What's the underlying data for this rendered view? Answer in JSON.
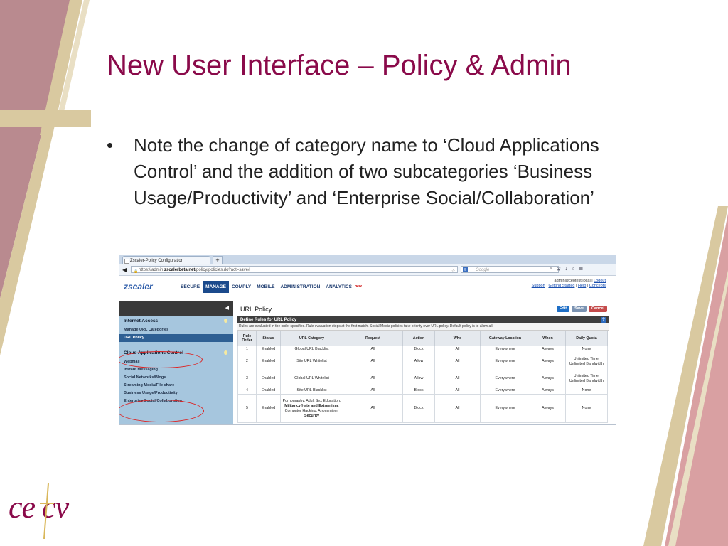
{
  "slide": {
    "title": "New User Interface – Policy & Admin",
    "bullet": "Note the change of category name to ‘Cloud Applications Control’ and the addition of two subcategories ‘Business Usage/Productivity’ and ‘Enterprise Social/Collaboration’",
    "logo": "ce  cv"
  },
  "colors": {
    "title": "#8a0a4a",
    "accent_tan": "#d9c9a0",
    "accent_rose": "#b98a8f"
  },
  "browser": {
    "tab_title": "Zscaler-Policy Configuration",
    "new_tab": "+",
    "url_prefix": "https://admin.",
    "url_host": "zscalerbeta.net",
    "url_path": "/policy/policies.do?act=save#",
    "search_engine": "Google",
    "search_placeholder": "Google"
  },
  "app": {
    "logo": "zscaler",
    "nav": [
      "SECURE",
      "MANAGE",
      "COMPLY",
      "MOBILE",
      "ADMINISTRATION",
      "ANALYTICS"
    ],
    "nav_new": "new",
    "user": "admin@ceotest.local",
    "logout": "Logout",
    "support": "Support",
    "getting_started": "Getting Started",
    "help": "Help",
    "concepts": "Concepts"
  },
  "sidebar": {
    "sections": [
      {
        "title": "Internet Access",
        "items": [
          "Manage URL Categories",
          "URL Policy"
        ]
      },
      {
        "title": "Cloud Applications Control",
        "items": [
          "Webmail",
          "Instant Messaging",
          "Social Networks/Blogs",
          "Streaming Media/File share",
          "Business Usage/Productivity",
          "Enterprise Social/Collaboration"
        ]
      }
    ]
  },
  "main": {
    "title": "URL Policy",
    "buttons": {
      "edit": "Edit",
      "save": "Save",
      "cancel": "Cancel"
    },
    "define_title": "Define Rules for URL Policy",
    "help": "?",
    "note": "Rules are evaluated in the order specified. Rule evaluation stops at the first match. Social Media policies take priority over URL policy. Default policy is to allow all.",
    "columns": [
      "Rule Order",
      "Status",
      "URL Category",
      "Request",
      "Action",
      "Who",
      "Gateway Location",
      "When",
      "Daily Quota"
    ],
    "rows": [
      {
        "order": "1",
        "status": "Enabled",
        "category": "Global URL Blacklist",
        "request": "All",
        "action": "Block",
        "who": "All",
        "gateway": "Everywhere",
        "when": "Always",
        "quota": "None"
      },
      {
        "order": "2",
        "status": "Enabled",
        "category": "Site URL Whitelist",
        "request": "All",
        "action": "Allow",
        "who": "All",
        "gateway": "Everywhere",
        "when": "Always",
        "quota": "Unlimited Time, Unlimited Bandwidth"
      },
      {
        "order": "3",
        "status": "Enabled",
        "category": "Global URL Whitelist",
        "request": "All",
        "action": "Allow",
        "who": "All",
        "gateway": "Everywhere",
        "when": "Always",
        "quota": "Unlimited Time, Unlimited Bandwidth"
      },
      {
        "order": "4",
        "status": "Enabled",
        "category": "Site URL Blacklist",
        "request": "All",
        "action": "Block",
        "who": "All",
        "gateway": "Everywhere",
        "when": "Always",
        "quota": "None"
      },
      {
        "order": "5",
        "status": "Enabled",
        "category_parts": [
          "Pornography, Adult Sex Education, ",
          "Militancy/Hate and Extremism",
          ", Computer Hacking, Anonymizer, ",
          "Security"
        ],
        "request": "All",
        "action": "Block",
        "who": "All",
        "gateway": "Everywhere",
        "when": "Always",
        "quota": "None"
      }
    ]
  }
}
